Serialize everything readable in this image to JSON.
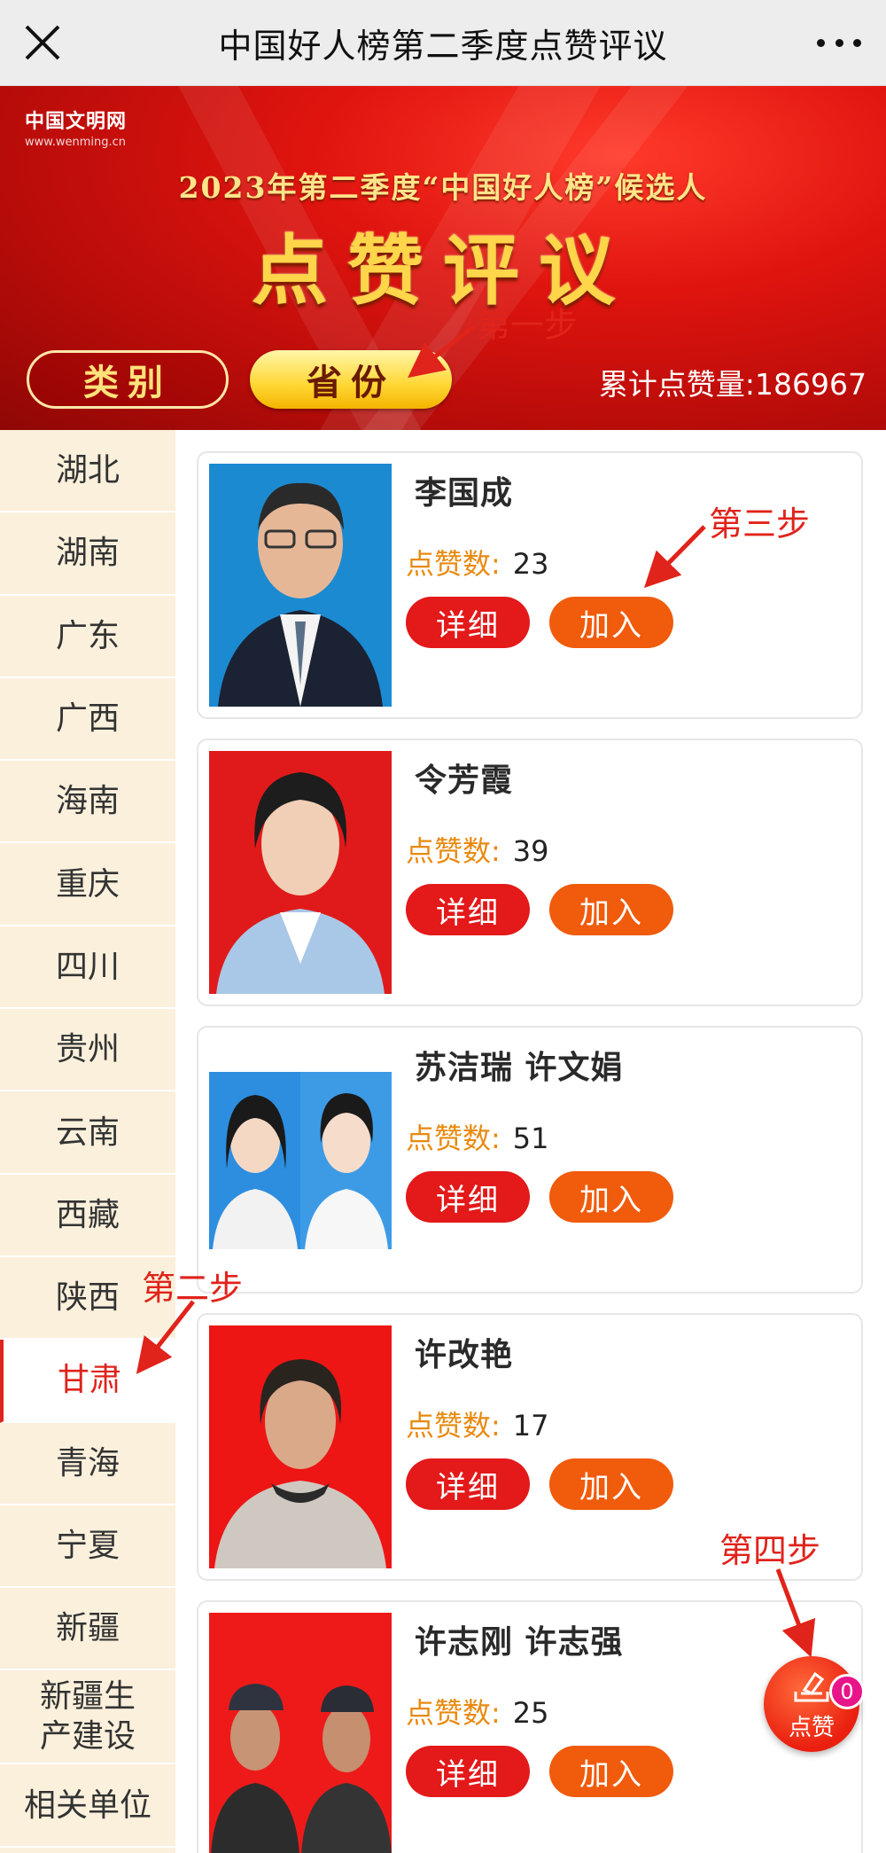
{
  "navbar": {
    "title": "中国好人榜第二季度点赞评议"
  },
  "banner": {
    "logo_cn": "中国文明网",
    "logo_en": "www.wenming.cn",
    "subtitle": "2023年第二季度“中国好人榜”候选人",
    "title": "点赞评议",
    "tab_category": "类别",
    "tab_province": "省份",
    "total_label": "累计点赞量:",
    "total_value": "186967"
  },
  "sidebar": {
    "items": [
      "湖北",
      "湖南",
      "广东",
      "广西",
      "海南",
      "重庆",
      "四川",
      "贵州",
      "云南",
      "西藏",
      "陕西",
      "甘肃",
      "青海",
      "宁夏",
      "新疆",
      "新疆生产建设",
      "相关单位"
    ],
    "active": "甘肃"
  },
  "cards": [
    {
      "name": "李国成",
      "like_label": "点赞数:",
      "likes": "23",
      "detail_label": "详细",
      "join_label": "加入"
    },
    {
      "name": "令芳霞",
      "like_label": "点赞数:",
      "likes": "39",
      "detail_label": "详细",
      "join_label": "加入"
    },
    {
      "name": "苏洁瑞  许文娟",
      "like_label": "点赞数:",
      "likes": "51",
      "detail_label": "详细",
      "join_label": "加入"
    },
    {
      "name": "许改艳",
      "like_label": "点赞数:",
      "likes": "17",
      "detail_label": "详细",
      "join_label": "加入"
    },
    {
      "name": "许志刚  许志强",
      "like_label": "点赞数:",
      "likes": "25",
      "detail_label": "详细",
      "join_label": "加入"
    }
  ],
  "annotations": {
    "step1": "第一步",
    "step2": "第二步",
    "step3": "第三步",
    "step4": "第四步"
  },
  "fab": {
    "label": "点赞",
    "badge": "0"
  },
  "colors": {
    "primary_red": "#e3191a",
    "join_orange": "#f05b0c",
    "like_label": "#e88a10",
    "sidebar_bg": "#fbf0dc",
    "banner_gold": "#ffd54a"
  },
  "icons": [
    "close-icon",
    "more-icon",
    "like-ballot-icon"
  ]
}
